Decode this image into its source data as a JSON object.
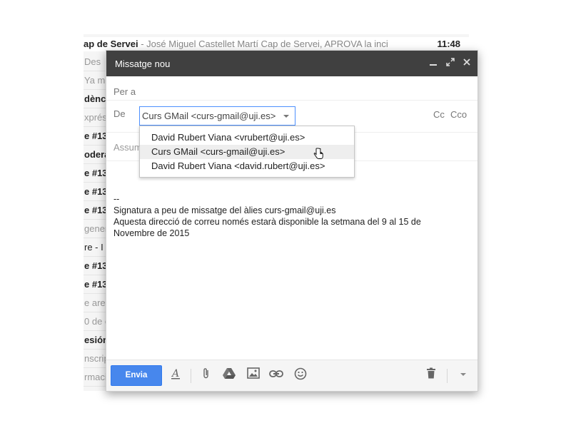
{
  "inbox": {
    "top_row": {
      "sender": "ap de Servei",
      "snippet": " - José Miguel Castellet Martí Cap de Servei, APROVA la inci",
      "time": "11:48"
    },
    "rows": [
      {
        "text": "Des",
        "style": "muted"
      },
      {
        "text": "Ya mo",
        "style": "muted"
      },
      {
        "text": "dència",
        "style": "unread"
      },
      {
        "text": "xprés",
        "style": "muted"
      },
      {
        "text": "e #13",
        "style": "unread"
      },
      {
        "text": "odera",
        "style": "unread"
      },
      {
        "text": "e #13",
        "style": "unread"
      },
      {
        "text": "e #13",
        "style": "unread"
      },
      {
        "text": "e #13",
        "style": "unread"
      },
      {
        "text": "genera",
        "style": "muted"
      },
      {
        "text": "re -  I",
        "style": "normal"
      },
      {
        "text": "e #13",
        "style": "unread"
      },
      {
        "text": "e #13",
        "style": "unread"
      },
      {
        "text": "e are",
        "style": "muted"
      },
      {
        "text": "0 de o",
        "style": "muted"
      },
      {
        "text": "esión",
        "style": "unread"
      },
      {
        "text": "nscrip",
        "style": "muted"
      },
      {
        "text": "rmaci",
        "style": "muted"
      }
    ]
  },
  "compose": {
    "title": "Missatge nou",
    "minimize_icon": "minimize-icon",
    "fullscreen_icon": "fullscreen-icon",
    "close_icon": "close-icon",
    "to_label": "Per a",
    "from_label": "De",
    "from_selected": "Curs GMail <curs-gmail@uji.es>",
    "cc_label": "Cc",
    "cco_label": "Cco",
    "subject_placeholder": "Assumpte",
    "from_options": [
      "David Rubert Viana <vrubert@uji.es>",
      "Curs GMail <curs-gmail@uji.es>",
      "David Rubert Viana <david.rubert@uji.es>"
    ],
    "hovered_option_index": 1,
    "body_lines": [
      "--",
      "Signatura a peu de missatge del àlies curs-gmail@uji.es",
      "Aquesta direcció de correu només estarà disponible la setmana del 9 al 15 de",
      "Novembre de 2015"
    ],
    "send_label": "Envia"
  },
  "colors": {
    "header_bg": "#404040",
    "send_bg": "#4787ed",
    "focus_border": "#4d90fe"
  }
}
